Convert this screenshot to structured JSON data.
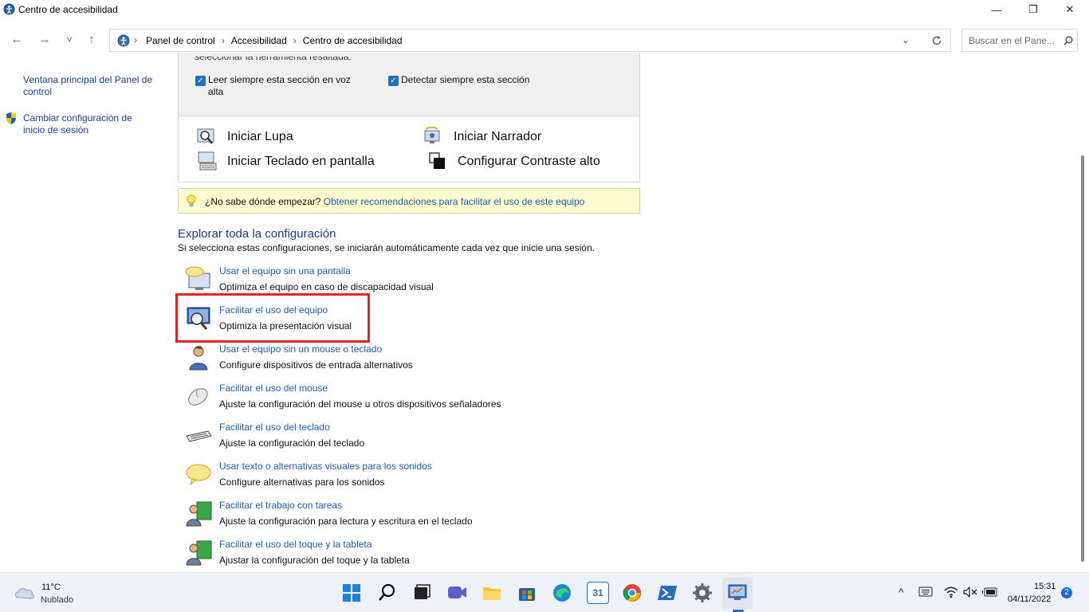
{
  "window": {
    "title": "Centro de accesibilidad",
    "minimize": "—",
    "restore": "❐",
    "close": "✕"
  },
  "nav": {
    "back": "←",
    "forward": "→",
    "recent": "˅",
    "up": "↑",
    "breadcrumbs": [
      "Panel de control",
      "Accesibilidad",
      "Centro de accesibilidad"
    ],
    "search_placeholder": "Buscar en el Pane..."
  },
  "sidebar": {
    "items": [
      {
        "label": "Ventana principal del Panel de control"
      },
      {
        "label": "Cambiar configuración de inicio de sesión"
      }
    ]
  },
  "panel": {
    "clipped_text": "seleccionar la herramienta resaltada.",
    "checkboxes": [
      {
        "label": "Leer siempre esta sección en voz alta",
        "checked": true
      },
      {
        "label": "Detectar siempre esta sección",
        "checked": true
      }
    ]
  },
  "tools": [
    {
      "label": "Iniciar Lupa"
    },
    {
      "label": "Iniciar Narrador"
    },
    {
      "label": "Iniciar Teclado en pantalla"
    },
    {
      "label": "Configurar Contraste alto"
    }
  ],
  "tip": {
    "question": "¿No sabe dónde empezar?",
    "link": "Obtener recomendaciones para facilitar el uso de este equipo"
  },
  "explore": {
    "title": "Explorar toda la configuración",
    "description": "Si selecciona estas configuraciones, se iniciarán automáticamente cada vez que inicie una sesión.",
    "items": [
      {
        "link": "Usar el equipo sin una pantalla",
        "desc": "Optimiza el equipo en caso de discapacidad visual"
      },
      {
        "link": "Facilitar el uso del equipo",
        "desc": "Optimiza la presentación visual"
      },
      {
        "link": "Usar el equipo sin un mouse o teclado",
        "desc": "Configure dispositivos de entrada alternativos"
      },
      {
        "link": "Facilitar el uso del mouse",
        "desc": "Ajuste la configuración del mouse u otros dispositivos señaladores"
      },
      {
        "link": "Facilitar el uso del teclado",
        "desc": "Ajuste la configuración del teclado"
      },
      {
        "link": "Usar texto o alternativas visuales para los sonidos",
        "desc": "Configure alternativas para los sonidos"
      },
      {
        "link": "Facilitar el trabajo con tareas",
        "desc": "Ajuste la configuración para lectura y escritura en el teclado"
      },
      {
        "link": "Facilitar el uso del toque y la tableta",
        "desc": "Ajustar la configuración del toque y la tableta"
      }
    ]
  },
  "taskbar": {
    "weather_temp": "11°C",
    "weather_desc": "Nublado",
    "time": "15:31",
    "date": "04/11/2022",
    "notification_count": "2",
    "calendar_day": "31",
    "tray_chevron": "^"
  },
  "colors": {
    "link": "#1a5fb0",
    "highlight": "#e8202a",
    "tip_bg": "#fefbd0"
  }
}
